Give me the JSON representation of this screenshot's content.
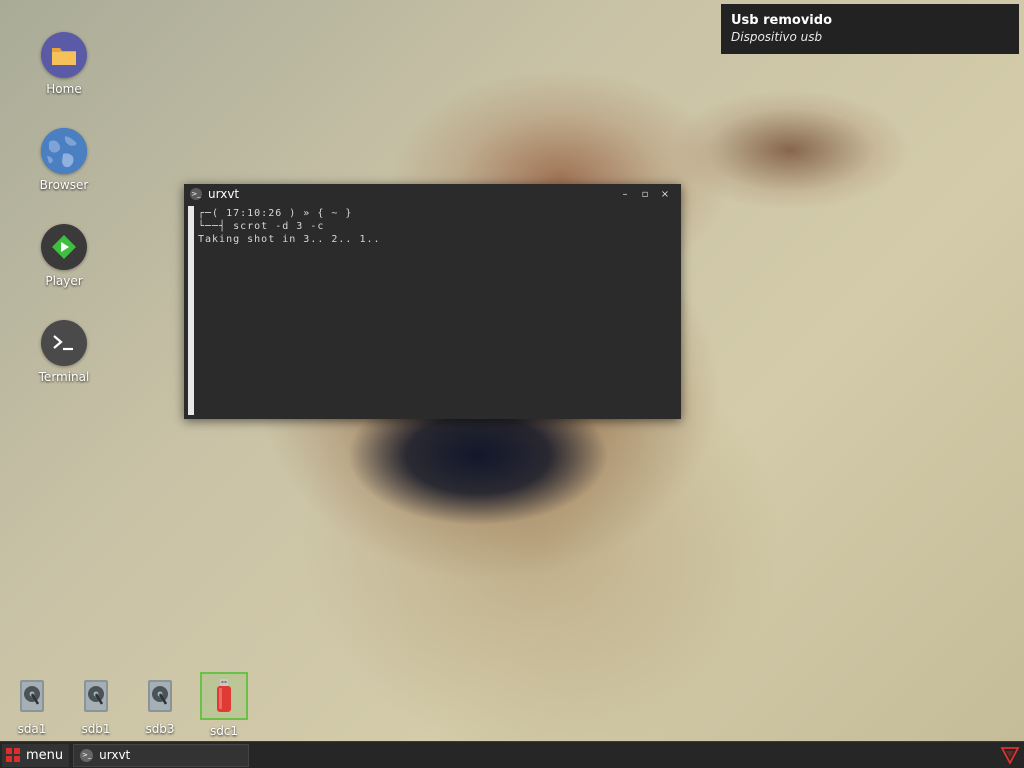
{
  "desktop_icons": [
    {
      "label": "Home",
      "icon": "folder-icon"
    },
    {
      "label": "Browser",
      "icon": "globe-icon"
    },
    {
      "label": "Player",
      "icon": "play-icon"
    },
    {
      "label": "Terminal",
      "icon": "terminal-icon"
    }
  ],
  "drives": [
    {
      "label": "sda1",
      "icon": "hard-disk-icon"
    },
    {
      "label": "sdb1",
      "icon": "hard-disk-icon"
    },
    {
      "label": "sdb3",
      "icon": "hard-disk-icon"
    },
    {
      "label": "sdc1",
      "icon": "usb-drive-icon",
      "selected": true
    }
  ],
  "notification": {
    "title": "Usb removido",
    "body": "Dispositivo usb"
  },
  "terminal": {
    "title": "urxvt",
    "lines": [
      "┌─( 17:10:26 ) » { ~ }",
      "└──┤ scrot -d 3 -c",
      "Taking shot in 3.. 2.. 1.."
    ],
    "buttons": {
      "minimize": "–",
      "maximize": "▫",
      "close": "×"
    }
  },
  "taskbar": {
    "menu_label": "menu",
    "tasks": [
      {
        "label": "urxvt",
        "icon": "terminal-icon"
      }
    ],
    "tray_icon": "red-triangle-icon"
  },
  "colors": {
    "accent_red": "#d9302c",
    "selection_green": "#6cc04a",
    "terminal_bg": "#2b2b2b",
    "taskbar_bg": "#262626"
  }
}
